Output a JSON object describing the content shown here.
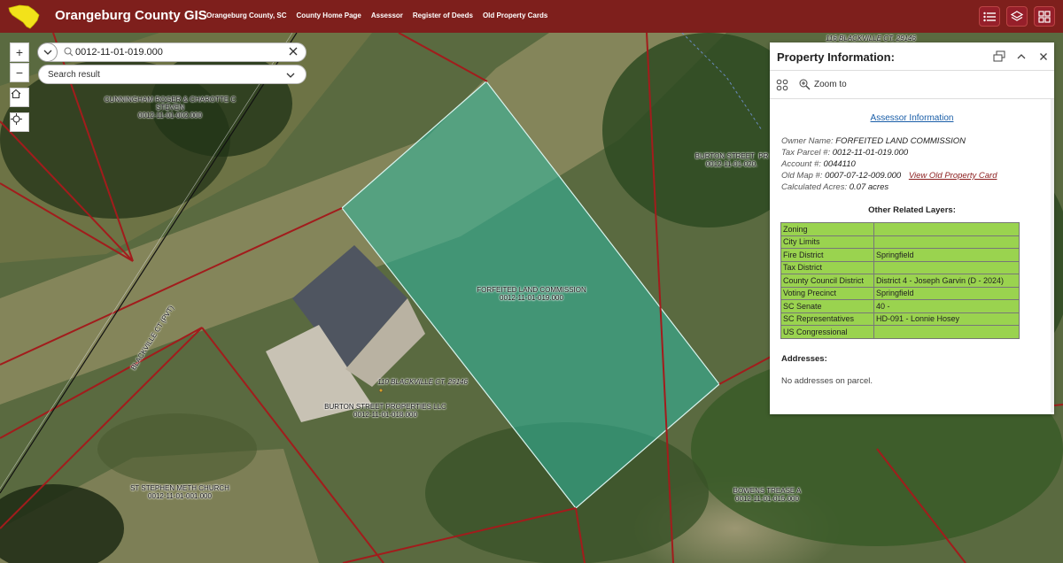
{
  "header": {
    "title": "Orangeburg County GIS",
    "nav": [
      "Orangeburg County, SC",
      "County Home Page",
      "Assessor",
      "Register of Deeds",
      "Old Property Cards"
    ],
    "bg_color": "#7e1f1c",
    "icons": [
      "list-icon",
      "layers-icon",
      "basemap-gallery-icon"
    ]
  },
  "map_controls": {
    "zoom_in": "+",
    "zoom_out": "−",
    "home_icon": "home-icon",
    "locate_icon": "locate-icon"
  },
  "search": {
    "value": "0012-11-01-019.000",
    "result_label": "Search result"
  },
  "map_labels": [
    {
      "id": "cunningham",
      "text": "CUNNINGHAM ROGER & CHAROTTE C\nSTEVEN\n0012-11-01-002.000"
    },
    {
      "id": "blackville-road",
      "text": "BLACKVILLE CT (PVT)"
    },
    {
      "id": "forfeited",
      "text": "FORFEITED LAND COMMISSION\n0012-11-01-019.000"
    },
    {
      "id": "address-110",
      "text": "110 BLACKVILLE CT, 29146"
    },
    {
      "id": "burton-llc",
      "text": "BURTON STREET PROPERTIES LLC\n0012-11-01-018.000"
    },
    {
      "id": "burton-street-right",
      "text": "BURTON STREET  PR\n0012-11-01-020."
    },
    {
      "id": "address-116",
      "text": "116 BLACKVILLE CT, 29146"
    },
    {
      "id": "st-stephen",
      "text": "ST STEPHEN METH CHURCH\n0012-11-01-001.000"
    },
    {
      "id": "bowens",
      "text": "BOWENS TREASE A\n0012-11-01-015.000"
    }
  ],
  "panel": {
    "title": "Property Information:",
    "zoom_to": "Zoom to",
    "assessor_link": "Assessor Information",
    "owner_label": "Owner Name:",
    "owner_value": "FORFEITED LAND COMMISSION",
    "parcel_label": "Tax Parcel #:",
    "parcel_value": "0012-11-01-019.000",
    "account_label": "Account #:",
    "account_value": "0044110",
    "oldmap_label": "Old Map #:",
    "oldmap_value": "0007-07-12-009.000",
    "old_card_link": "View Old Property Card",
    "acres_label": "Calculated Acres:",
    "acres_value": "0.07 acres",
    "related_title": "Other Related Layers:",
    "layers": [
      {
        "key": "Zoning",
        "value": ""
      },
      {
        "key": "City Limits",
        "value": ""
      },
      {
        "key": "Fire District",
        "value": "Springfield"
      },
      {
        "key": "Tax District",
        "value": ""
      },
      {
        "key": "County Council District",
        "value": "District 4 - Joseph Garvin (D - 2024)"
      },
      {
        "key": "Voting Precinct",
        "value": "Springfield"
      },
      {
        "key": "SC Senate",
        "value": "40 -"
      },
      {
        "key": "SC Representatives",
        "value": "HD-091 - Lonnie Hosey"
      },
      {
        "key": "US Congressional",
        "value": ""
      }
    ],
    "addresses_title": "Addresses:",
    "addresses_none": "No addresses on parcel.",
    "table_color": "#9ad34f",
    "link_color": "#1a5ea8",
    "card_link_color": "#8a1c1c"
  }
}
